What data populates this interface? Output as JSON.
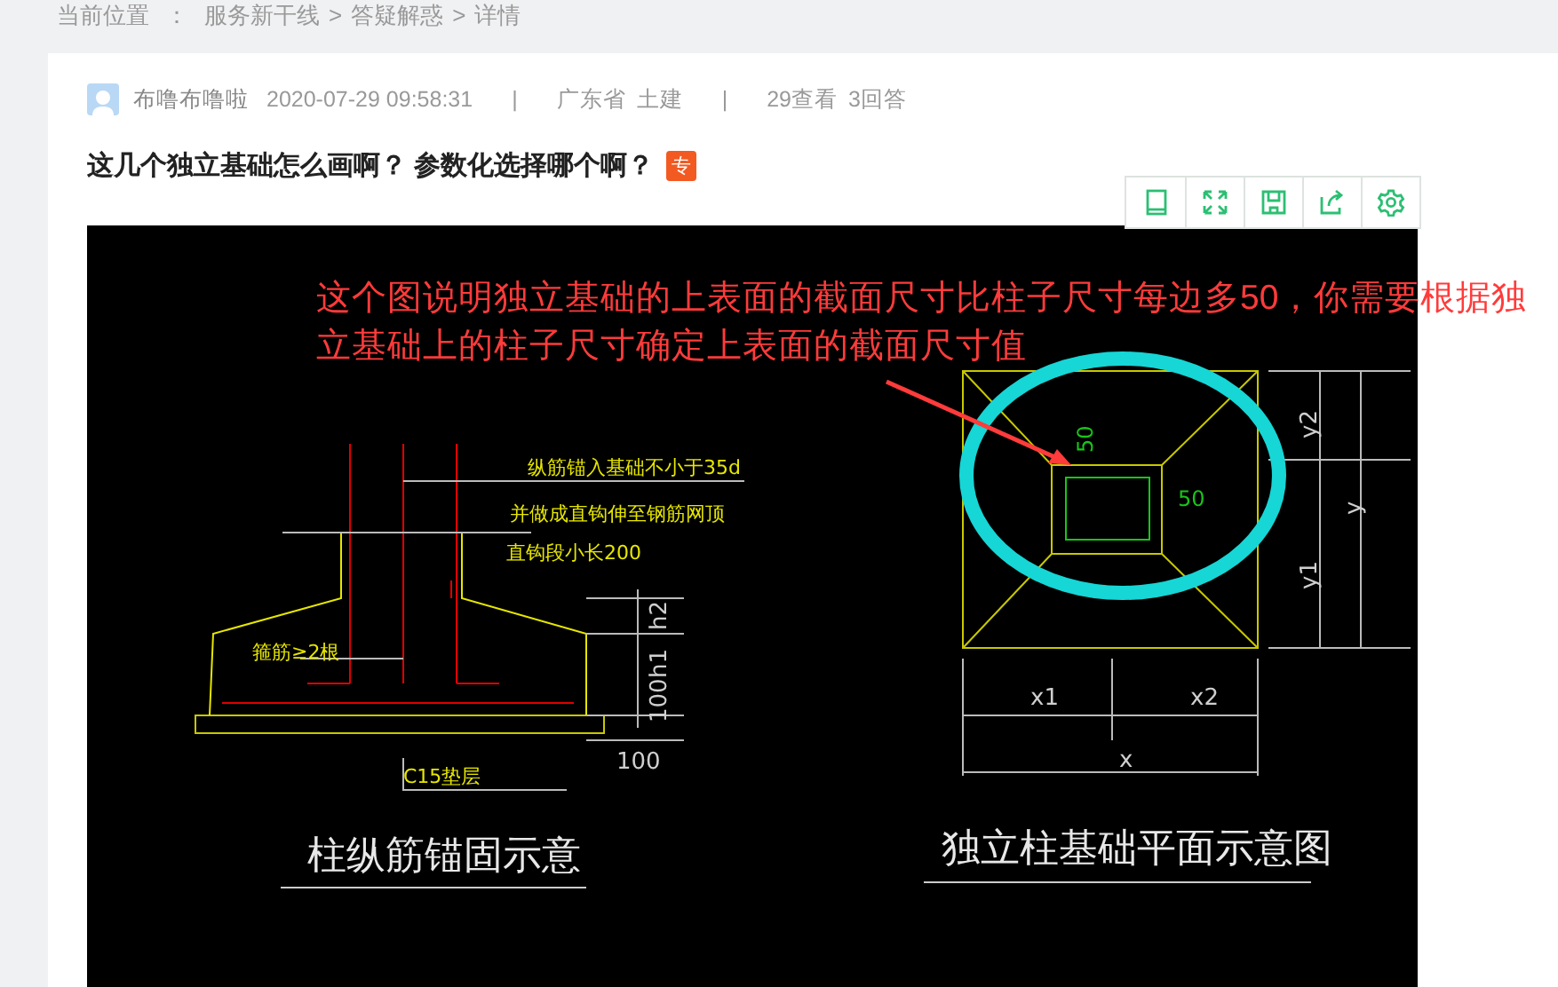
{
  "breadcrumb": {
    "label": "当前位置",
    "separator": "：",
    "items": [
      "服务新干线",
      "答疑解惑",
      "详情"
    ],
    "arrow": ">"
  },
  "meta": {
    "author": "布噜布噜啦",
    "date": "2020-07-29 09:58:31",
    "divider": "|",
    "region": "广东省",
    "category": "土建",
    "views": "29查看",
    "answers": "3回答"
  },
  "question": {
    "title": "这几个独立基础怎么画啊？ 参数化选择哪个啊？",
    "badge": "专"
  },
  "toolbar": [
    {
      "kind": "tablet"
    },
    {
      "kind": "fullscreen"
    },
    {
      "kind": "save"
    },
    {
      "kind": "share"
    },
    {
      "kind": "settings"
    }
  ],
  "drawing": {
    "annotation": "这个图说明独立基础的上表面的截面尺寸比柱子尺寸每边多50，你需要根据独立基础上的柱子尺寸确定上表面的截面尺寸值",
    "labels": [
      {
        "text": "纵筋锚入基础不小于35d",
        "kind": "note"
      },
      {
        "text": "并做成直钩伸至钢筋网顶",
        "kind": "note"
      },
      {
        "text": "直钩段小长200",
        "kind": "note"
      },
      {
        "text": "箍筋≥2根",
        "kind": "note"
      },
      {
        "text": "h2",
        "kind": "dim-v"
      },
      {
        "text": "h1",
        "kind": "dim-v"
      },
      {
        "text": "100",
        "kind": "dim-v"
      },
      {
        "text": "C15垫层",
        "kind": "note"
      },
      {
        "text": "100",
        "kind": "dim"
      },
      {
        "text": "柱纵筋锚固示意",
        "kind": "caption"
      },
      {
        "text": "50",
        "kind": "green-v"
      },
      {
        "text": "50",
        "kind": "green"
      },
      {
        "text": "y2",
        "kind": "dim-v"
      },
      {
        "text": "y",
        "kind": "dim-v"
      },
      {
        "text": "y1",
        "kind": "dim-v"
      },
      {
        "text": "x1",
        "kind": "dim"
      },
      {
        "text": "x2",
        "kind": "dim"
      },
      {
        "text": "x",
        "kind": "dim"
      },
      {
        "text": "独立柱基础平面示意图",
        "kind": "caption"
      }
    ]
  }
}
